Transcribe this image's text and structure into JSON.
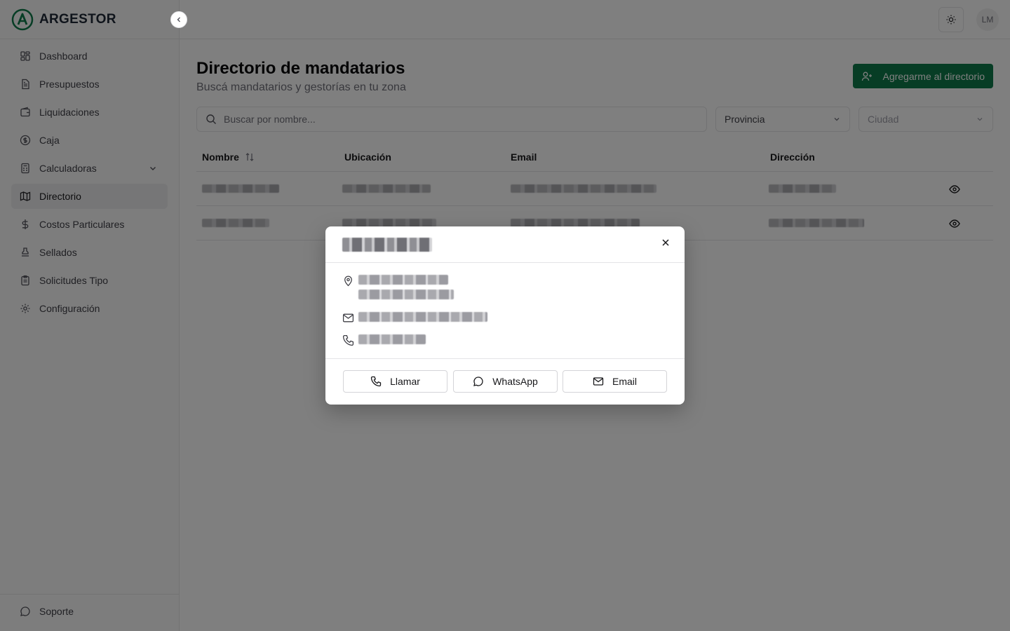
{
  "app": {
    "name": "ARGESTOR",
    "user_initials": "LM"
  },
  "sidebar": {
    "items": [
      {
        "label": "Dashboard",
        "icon": "dashboard-icon"
      },
      {
        "label": "Presupuestos",
        "icon": "document-icon"
      },
      {
        "label": "Liquidaciones",
        "icon": "wallet-icon"
      },
      {
        "label": "Caja",
        "icon": "dollar-circle-icon"
      },
      {
        "label": "Calculadoras",
        "icon": "calculator-icon"
      },
      {
        "label": "Directorio",
        "icon": "map-icon"
      },
      {
        "label": "Costos Particulares",
        "icon": "dollar-icon"
      },
      {
        "label": "Sellados",
        "icon": "stamp-icon"
      },
      {
        "label": "Solicitudes Tipo",
        "icon": "clipboard-icon"
      },
      {
        "label": "Configuración",
        "icon": "gear-icon"
      }
    ],
    "support_label": "Soporte"
  },
  "header": {
    "title": "Directorio de mandatarios",
    "subtitle": "Buscá mandatarios y gestorías en tu zona",
    "add_button": "Agregarme al directorio"
  },
  "filters": {
    "search_placeholder": "Buscar por nombre...",
    "province_value": "Provincia",
    "city_value": "Ciudad"
  },
  "table": {
    "columns": [
      "Nombre",
      "Ubicación",
      "Email",
      "Dirección"
    ]
  },
  "modal": {
    "buttons": {
      "call": "Llamar",
      "whatsapp": "WhatsApp",
      "email": "Email"
    }
  },
  "colors": {
    "accent": "#0f7a4a"
  }
}
